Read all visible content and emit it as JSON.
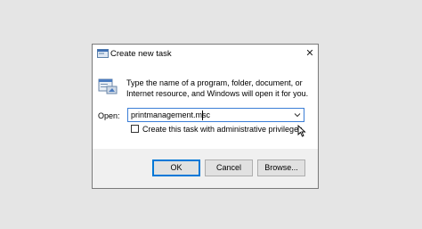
{
  "dialog": {
    "title": "Create new task",
    "close_glyph": "✕",
    "description": "Type the name of a program, folder, document, or Internet resource, and Windows will open it for you.",
    "open_label": "Open:",
    "open_value": "printmanagement.msc",
    "checkbox_label": "Create this task with administrative privileges.",
    "checkbox_checked": false,
    "buttons": {
      "ok": "OK",
      "cancel": "Cancel",
      "browse": "Browse..."
    }
  },
  "icons": {
    "title": "run-dialog-icon",
    "app": "run-program-icon",
    "dropdown": "chevron-down-icon",
    "pointer": "mouse-pointer-icon"
  },
  "colors": {
    "focus_border": "#0078d7",
    "footer_bg": "#f0f0f0",
    "button_bg": "#e1e1e1"
  }
}
